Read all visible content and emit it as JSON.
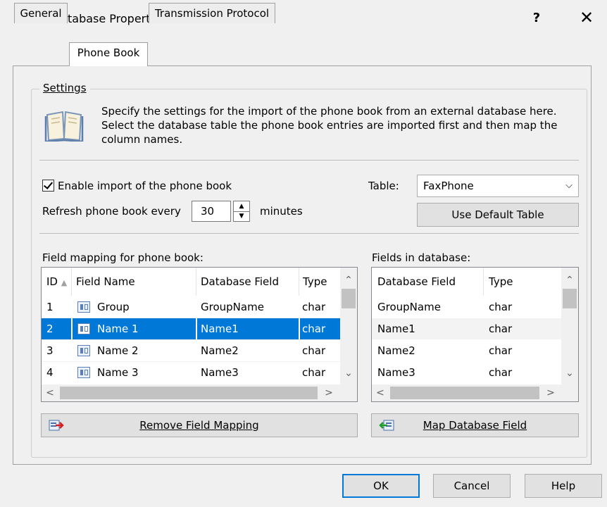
{
  "window": {
    "title": "ODBC Database Properties",
    "help_label": "?",
    "close_label": "✕"
  },
  "tabs": [
    {
      "label": "General",
      "active": false
    },
    {
      "label": "Phone Book",
      "active": true
    },
    {
      "label": "Transmission Protocol",
      "active": false
    }
  ],
  "settings": {
    "group_title": "Settings",
    "description": "Specify the settings for the import of the phone book from an external database here. Select the database table the phone book entries are imported first and then map the column names.",
    "enable_import_label": "Enable import of the phone book",
    "enable_import_checked": true,
    "refresh_label": "Refresh phone book every",
    "refresh_value": "30",
    "refresh_unit": "minutes",
    "table_label": "Table:",
    "table_value": "FaxPhone",
    "use_default_table_label": "Use Default Table"
  },
  "mapping": {
    "label": "Field mapping for phone book:",
    "columns": [
      "ID",
      "Field Name",
      "Database Field",
      "Type"
    ],
    "rows": [
      {
        "id": "1",
        "field": "Group",
        "db_field": "GroupName",
        "type": "char",
        "selected": false
      },
      {
        "id": "2",
        "field": "Name 1",
        "db_field": "Name1",
        "type": "char",
        "selected": true
      },
      {
        "id": "3",
        "field": "Name 2",
        "db_field": "Name2",
        "type": "char",
        "selected": false
      },
      {
        "id": "4",
        "field": "Name 3",
        "db_field": "Name3",
        "type": "char",
        "selected": false
      }
    ],
    "remove_button_label": "Remove Field Mapping"
  },
  "db_fields": {
    "label": "Fields in database:",
    "columns": [
      "Database Field",
      "Type"
    ],
    "rows": [
      {
        "db_field": "GroupName",
        "type": "char"
      },
      {
        "db_field": "Name1",
        "type": "char"
      },
      {
        "db_field": "Name2",
        "type": "char"
      },
      {
        "db_field": "Name3",
        "type": "char"
      }
    ],
    "map_button_label": "Map Database Field"
  },
  "footer": {
    "ok_label": "OK",
    "cancel_label": "Cancel",
    "help_label": "Help"
  },
  "colors": {
    "selection": "#0078d7",
    "button_face": "#e1e1e1",
    "window_bg": "#f0f0f0"
  }
}
